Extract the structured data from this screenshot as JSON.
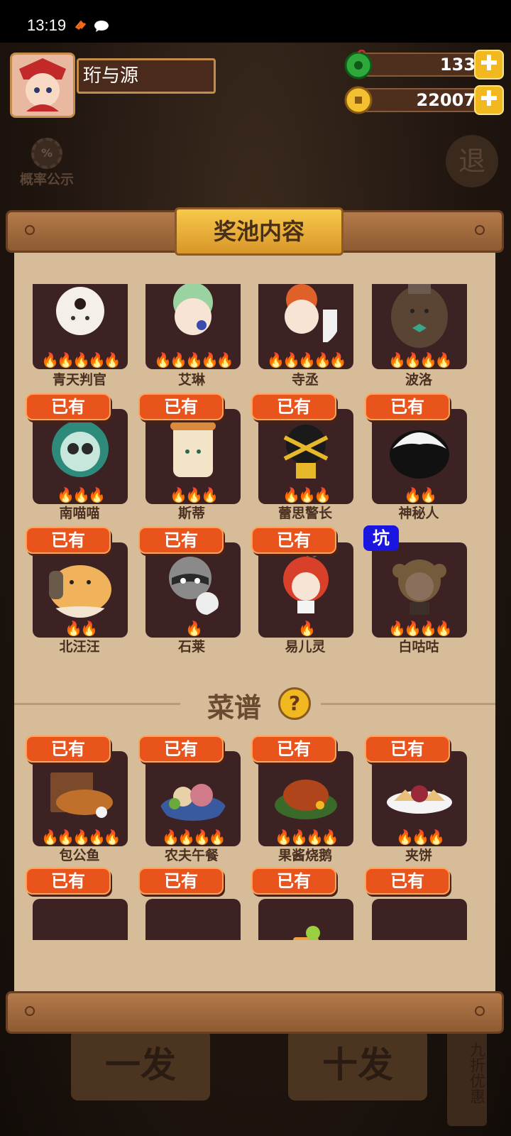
{
  "status_bar": {
    "time": "13:19"
  },
  "player": {
    "name": "珩与源"
  },
  "currencies": [
    {
      "name": "jade",
      "value": "133"
    },
    {
      "name": "coin",
      "value": "22007"
    }
  ],
  "plus_label": "✚",
  "probability_label": "概率公示",
  "probability_icon": "%",
  "exit_label": "退",
  "panel": {
    "title": "奖池内容"
  },
  "owned_label": "已有",
  "pit_label": "坑",
  "characters_row1": [
    {
      "name": "青天判官",
      "stars": 5
    },
    {
      "name": "艾琳",
      "stars": 5
    },
    {
      "name": "寺丞",
      "stars": 5
    },
    {
      "name": "波洛",
      "stars": 4
    }
  ],
  "characters_row2": [
    {
      "name": "南喵喵",
      "stars": 3,
      "owned": true
    },
    {
      "name": "斯蒂",
      "stars": 3,
      "owned": true
    },
    {
      "name": "蕾思警长",
      "stars": 3,
      "owned": true
    },
    {
      "name": "神秘人",
      "stars": 2,
      "owned": true
    }
  ],
  "characters_row3": [
    {
      "name": "北汪汪",
      "stars": 2,
      "owned": true
    },
    {
      "name": "石莱",
      "stars": 1,
      "owned": true
    },
    {
      "name": "易儿灵",
      "stars": 1,
      "owned": true
    },
    {
      "name": "白咕咕",
      "stars": 4,
      "pit": true
    }
  ],
  "recipes_section": {
    "title": "菜谱",
    "help": "?"
  },
  "recipes_row1": [
    {
      "name": "包公鱼",
      "stars": 5,
      "owned": true
    },
    {
      "name": "农夫午餐",
      "stars": 4,
      "owned": true
    },
    {
      "name": "果酱烧鹅",
      "stars": 4,
      "owned": true
    },
    {
      "name": "夹饼",
      "stars": 3,
      "owned": true
    }
  ],
  "recipes_row2": [
    {
      "name": "",
      "owned": true
    },
    {
      "name": "",
      "owned": true
    },
    {
      "name": "",
      "owned": true
    },
    {
      "name": "",
      "owned": true
    }
  ],
  "bottom_buttons": {
    "single": "一发",
    "ten": "十发",
    "discount": "九折优惠"
  },
  "colors": {
    "owned_badge": "#e9541c",
    "pit_badge": "#1a16e0",
    "paper": "#d6bc98",
    "banner": "#f2b820"
  }
}
